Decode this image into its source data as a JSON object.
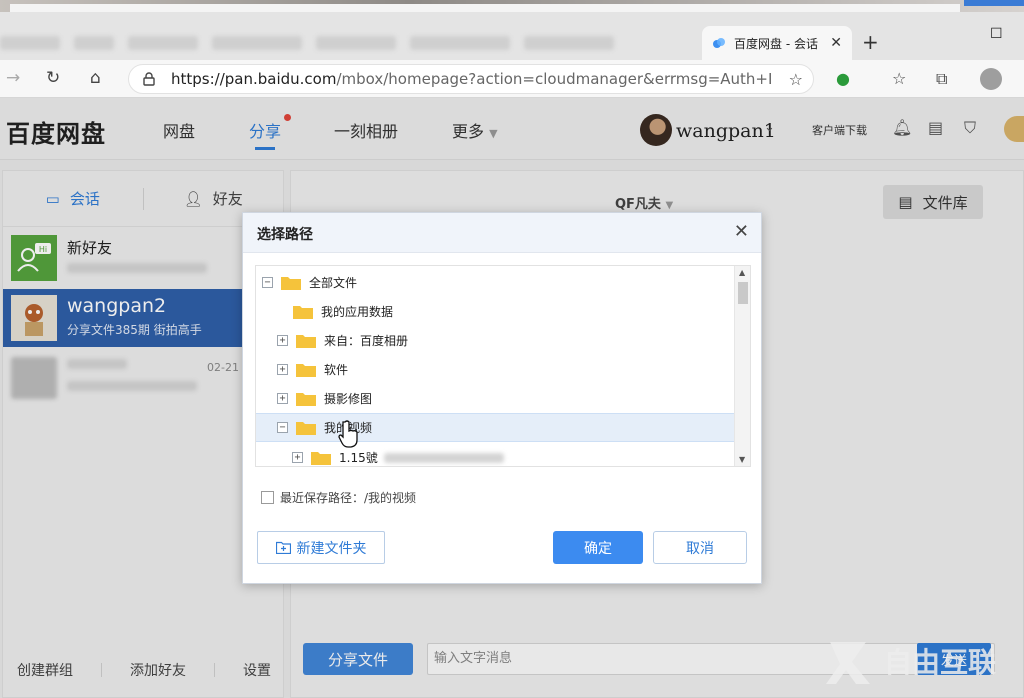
{
  "browser": {
    "tab_title": "百度网盘 - 会话",
    "url_main": "https://pan.baidu.com",
    "url_rest": "/mbox/homepage?action=cloudmanager&errmsg=Auth+Lo..."
  },
  "header": {
    "logo": "百度网盘",
    "nav": [
      "网盘",
      "分享",
      "一刻相册",
      "更多"
    ],
    "active_nav": "分享",
    "username": "wangpan1",
    "client_download": "客户端下载"
  },
  "left": {
    "tabs": [
      "会话",
      "好友"
    ],
    "conversations": [
      {
        "name": "新好友",
        "sub": ""
      },
      {
        "name": "wangpan2",
        "sub": "分享文件385期 街拍高手"
      },
      {
        "name": "",
        "sub": "",
        "date": "02-21"
      }
    ],
    "footer": [
      "创建群组",
      "添加好友",
      "设置"
    ]
  },
  "right": {
    "contact_name": "QF凡夫",
    "library_button": "文件库",
    "share_button": "分享文件",
    "message_placeholder": "输入文字消息",
    "send_button": "发送"
  },
  "dialog": {
    "title": "选择路径",
    "tree": [
      {
        "label": "全部文件",
        "level": 0,
        "toggle": "−"
      },
      {
        "label": "我的应用数据",
        "level": 1,
        "toggle": ""
      },
      {
        "label": "来自：百度相册",
        "level": 1,
        "toggle": "+"
      },
      {
        "label": "软件",
        "level": 1,
        "toggle": "+"
      },
      {
        "label": "摄影修图",
        "level": 1,
        "toggle": "+"
      },
      {
        "label": "我的视频",
        "level": 1,
        "toggle": "−",
        "selected": true
      },
      {
        "label": "1.15號",
        "level": 2,
        "toggle": "+"
      }
    ],
    "recent_path_label": "最近保存路径：/我的视频",
    "new_folder_button": "新建文件夹",
    "ok_button": "确定",
    "cancel_button": "取消"
  },
  "watermark_text": "自由互联",
  "colors": {
    "accent": "#2f7bd6",
    "selected_conv": "#2f5fa8",
    "folder": "#f5c33b"
  }
}
